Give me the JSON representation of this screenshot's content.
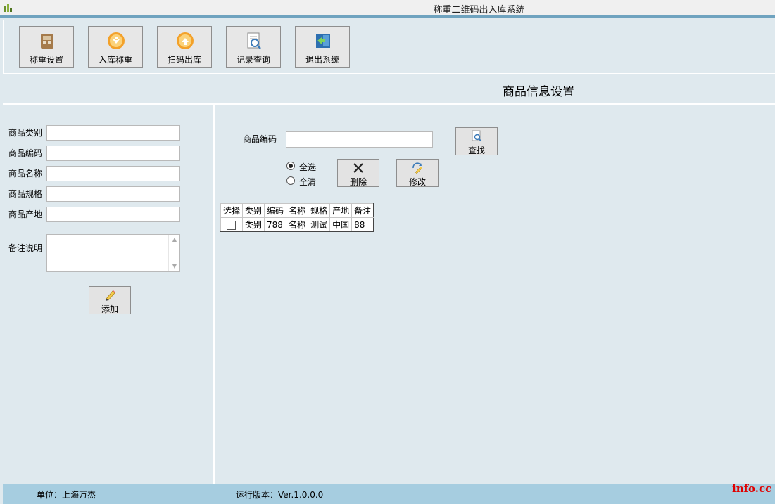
{
  "window": {
    "title": "称重二维码出入库系统"
  },
  "toolbar": {
    "buttons": [
      {
        "label": "称重设置",
        "icon": "scale-settings-icon"
      },
      {
        "label": "入库称重",
        "icon": "arrow-down-circle-icon"
      },
      {
        "label": "扫码出库",
        "icon": "arrow-up-circle-icon"
      },
      {
        "label": "记录查询",
        "icon": "magnifier-document-icon"
      },
      {
        "label": "退出系统",
        "icon": "exit-door-icon"
      }
    ]
  },
  "section": {
    "title": "商品信息设置"
  },
  "form": {
    "fields": [
      {
        "label": "商品类别",
        "value": ""
      },
      {
        "label": "商品编码",
        "value": ""
      },
      {
        "label": "商品名称",
        "value": ""
      },
      {
        "label": "商品规格",
        "value": ""
      },
      {
        "label": "商品产地",
        "value": ""
      }
    ],
    "notes_label": "备注说明",
    "notes_value": "",
    "add_label": "添加"
  },
  "search": {
    "label": "商品编码",
    "value": "",
    "find_label": "查找",
    "select_all": "全选",
    "clear_all": "全清",
    "selected_option": "全选",
    "delete_label": "删除",
    "edit_label": "修改"
  },
  "table": {
    "columns": [
      "选择",
      "类别",
      "编码",
      "名称",
      "规格",
      "产地",
      "备注"
    ],
    "rows": [
      {
        "checked": false,
        "cells": [
          "类别",
          "788",
          "名称",
          "测试",
          "中国",
          "88"
        ]
      }
    ]
  },
  "status": {
    "unit": "单位：上海万杰",
    "version": "运行版本：Ver.1.0.0.0"
  },
  "watermark": "info.cc",
  "colors": {
    "background": "#dfe9ee",
    "statusbar": "#a6cde0",
    "accent": "#6fa3bf"
  }
}
